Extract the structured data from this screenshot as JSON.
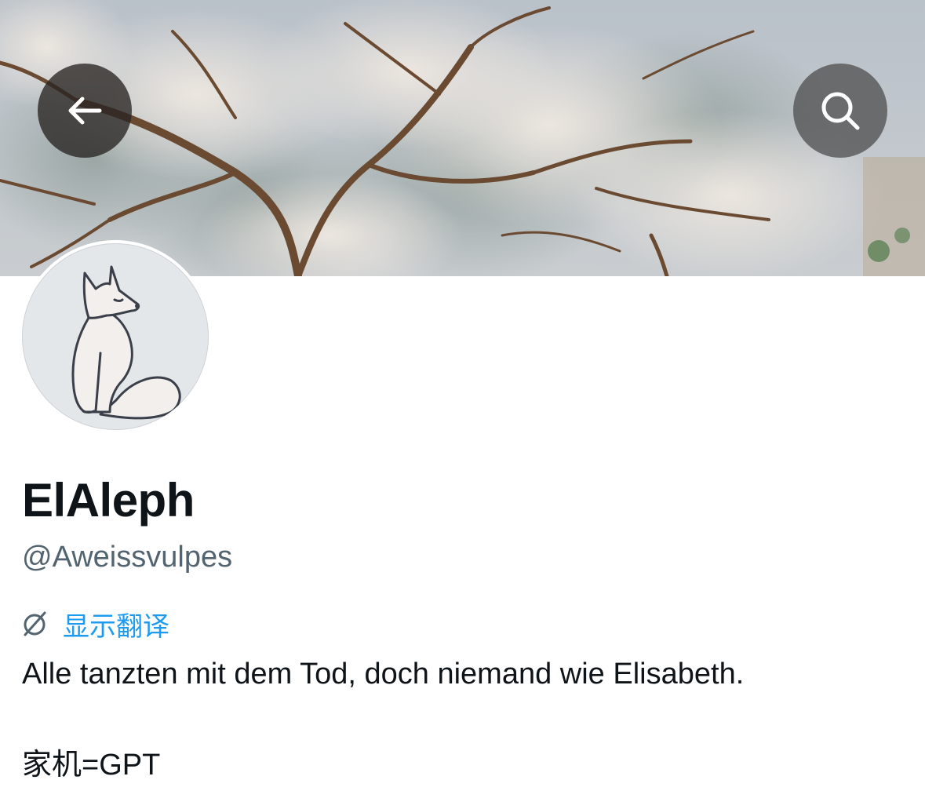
{
  "profile": {
    "display_name": "ElAleph",
    "handle": "@Aweissvulpes",
    "translate_label": "显示翻译",
    "bio_line1": "Alle tanzten mit dem Tod, doch niemand wie Elisabeth.",
    "bio_line2": "家机=GPT"
  },
  "icons": {
    "back": "arrow-left-icon",
    "search": "search-icon",
    "translate": "translate-icon"
  },
  "colors": {
    "accent": "#1d9bf0",
    "text_primary": "#0f1419",
    "text_secondary": "#536471"
  }
}
